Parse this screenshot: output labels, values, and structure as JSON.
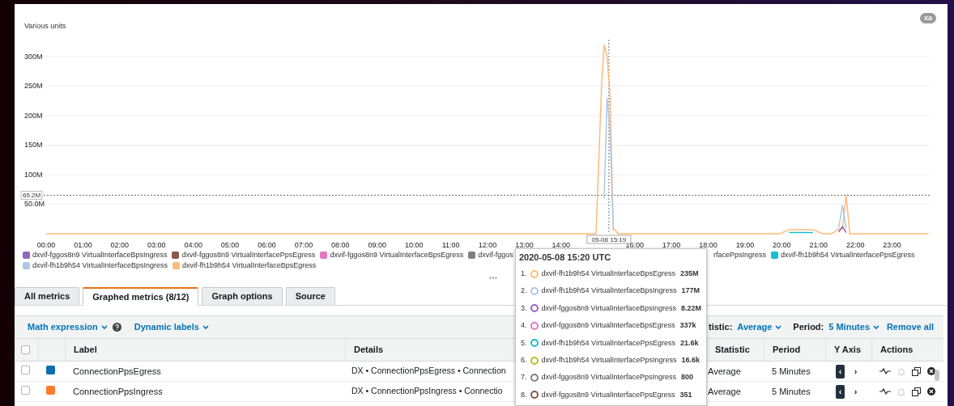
{
  "corner_badge": "xa",
  "chart": {
    "chart_data": {
      "type": "line",
      "ylabel": "Various units",
      "grid": true,
      "x": [
        0,
        14.95,
        15.1,
        15.17,
        15.25,
        15.33,
        15.42,
        15.55,
        19.95,
        20.2,
        20.85,
        21.1,
        21.35,
        21.55,
        21.65,
        21.75,
        21.85,
        23.99
      ],
      "xlim": [
        0,
        24
      ],
      "ylim": [
        0,
        330
      ],
      "series": [
        {
          "name": "dxvif-fggos8n9 VirtualInterfaceBpsIngress",
          "color": "#9467bd",
          "values": [
            null,
            null,
            null,
            null,
            null,
            null,
            null,
            null,
            null,
            null,
            null,
            null,
            null,
            3,
            12,
            2,
            null,
            null
          ]
        },
        {
          "name": "dxvif-fh1b9h54 VirtualInterfacePpsEgress",
          "color": "#17becf",
          "values": [
            null,
            null,
            null,
            null,
            null,
            null,
            null,
            null,
            null,
            2,
            2,
            null,
            null,
            null,
            null,
            null,
            null,
            null
          ]
        },
        {
          "name": "dxvif-fh1b9h54 VirtualInterfaceBpsIngress",
          "color": "#aec7e8",
          "values": [
            null,
            null,
            null,
            60,
            230,
            177,
            5,
            null,
            null,
            null,
            null,
            null,
            null,
            10,
            48,
            10,
            null,
            null
          ]
        },
        {
          "name": "dxvif-fh1b9h54 VirtualInterfaceBpsEgress",
          "color": "#ffbb78",
          "values": [
            0,
            0,
            250,
            320,
            300,
            235,
            10,
            0,
            0,
            7,
            7,
            0,
            0,
            8,
            8,
            65,
            0,
            0
          ]
        }
      ],
      "yticks": [
        {
          "value": 50,
          "label": "50.0M"
        },
        {
          "value": 100,
          "label": "100M"
        },
        {
          "value": 150,
          "label": "150M"
        },
        {
          "value": 200,
          "label": "200M"
        },
        {
          "value": 250,
          "label": "250M"
        },
        {
          "value": 300,
          "label": "300M"
        }
      ],
      "xticks": [
        {
          "value": 0,
          "label": "00:00"
        },
        {
          "value": 1,
          "label": "01:00"
        },
        {
          "value": 2,
          "label": "02:00"
        },
        {
          "value": 3,
          "label": "03:00"
        },
        {
          "value": 4,
          "label": "04:00"
        },
        {
          "value": 5,
          "label": "05:00"
        },
        {
          "value": 6,
          "label": "06:00"
        },
        {
          "value": 7,
          "label": "07:00"
        },
        {
          "value": 8,
          "label": "08:00"
        },
        {
          "value": 9,
          "label": "09:00"
        },
        {
          "value": 10,
          "label": "10:00"
        },
        {
          "value": 11,
          "label": "11:00"
        },
        {
          "value": 12,
          "label": "12:00"
        },
        {
          "value": 13,
          "label": "13:00"
        },
        {
          "value": 14,
          "label": "14:00"
        },
        {
          "value": 16,
          "label": "16:00"
        },
        {
          "value": 17,
          "label": "17:00"
        },
        {
          "value": 18,
          "label": "18:00"
        },
        {
          "value": 19,
          "label": "19:00"
        },
        {
          "value": 20,
          "label": "20:00"
        },
        {
          "value": 21,
          "label": "21:00"
        },
        {
          "value": 22,
          "label": "22:00"
        },
        {
          "value": 23,
          "label": "23:00"
        }
      ],
      "ref_lines": [
        {
          "axis": "y",
          "value": 65.2,
          "label": "65.2M"
        },
        {
          "axis": "x",
          "value": 15.3,
          "label": "05-08 15:19"
        }
      ]
    }
  },
  "legend": [
    {
      "kind": "series"
    },
    {
      "kind": "entry",
      "label": "dxvif-fggos8n9 VirtualInterfacePpsEgress",
      "color": "#8c564b"
    },
    {
      "kind": "entry",
      "label": "dxvif-fggos8n9 VirtualInterfaceBpsEgress",
      "color": "#e377c2"
    },
    {
      "kind": "entry",
      "label": "dxvif-fggos",
      "color": "#7f7f7f"
    },
    {
      "kind": "entry",
      "label": "rfacePpsIngress"
    },
    {
      "kind": "series"
    },
    {
      "kind": "series"
    },
    {
      "kind": "series"
    }
  ],
  "tooltip": {
    "title": "2020-05-08 15:20 UTC",
    "items": [
      {
        "index": "1.",
        "name": "dxvif-fh1b9h54 VirtualInterfaceBpsEgress",
        "value": "235M",
        "color": "#ffbb78"
      },
      {
        "index": "2.",
        "name": "dxvif-fh1b9h54 VirtualInterfaceBpsIngress",
        "value": "177M",
        "color": "#aec7e8"
      },
      {
        "index": "3.",
        "name": "dxvif-fggos8n9 VirtualInterfaceBpsIngress",
        "value": "8.22M",
        "color": "#9467bd"
      },
      {
        "index": "4.",
        "name": "dxvif-fggos8n9 VirtualInterfaceBpsEgress",
        "value": "337k",
        "color": "#e377c2"
      },
      {
        "index": "5.",
        "name": "dxvif-fh1b9h54 VirtualInterfacePpsEgress",
        "value": "21.6k",
        "color": "#17becf"
      },
      {
        "index": "6.",
        "name": "dxvif-fh1b9h54 VirtualInterfacePpsIngress",
        "value": "16.6k",
        "color": "#bcbd22"
      },
      {
        "index": "7.",
        "name": "dxvif-fggos8n9 VirtualInterfacePpsIngress",
        "value": "800",
        "color": "#7f7f7f"
      },
      {
        "index": "8.",
        "name": "dxvif-fggos8n9 VirtualInterfacePpsEgress",
        "value": "351",
        "color": "#8c564b"
      }
    ]
  },
  "tabs": [
    {
      "label": "All metrics",
      "selected": false
    },
    {
      "label": "Graphed metrics (8/12)",
      "selected": true
    },
    {
      "label": "Graph options",
      "selected": false
    },
    {
      "label": "Source",
      "selected": false
    }
  ],
  "toolbar": {
    "math_expression": "Math expression",
    "dynamic_labels": "Dynamic labels",
    "statistic_label": "tistic:",
    "statistic": "Average",
    "period_label": "Period:",
    "period": "5 Minutes",
    "remove_all": "Remove all"
  },
  "table": {
    "columns": [
      "Label",
      "Details",
      "Statistic",
      "Period",
      "Y Axis",
      "Actions"
    ],
    "all_checked": false,
    "rows": [
      {
        "checked": false,
        "color": "#0f6fb0",
        "label": "ConnectionPpsEgress",
        "details": "DX • ConnectionPpsEgress • Connection",
        "statistic": "Average",
        "period": "5 Minutes",
        "y_axis": [
          {
            "glyph": "‹",
            "selected": true
          },
          {
            "glyph": "›",
            "selected": false
          }
        ],
        "alarm_enabled": false
      },
      {
        "checked": false,
        "color": "#ff7b2a",
        "label": "ConnectionPpsIngress",
        "details": "DX • ConnectionPpsIngress • Connectio",
        "statistic": "Average",
        "period": "5 Minutes",
        "y_axis": [
          {
            "glyph": "‹",
            "selected": true
          },
          {
            "glyph": "›",
            "selected": false
          }
        ],
        "alarm_enabled": false
      }
    ]
  }
}
